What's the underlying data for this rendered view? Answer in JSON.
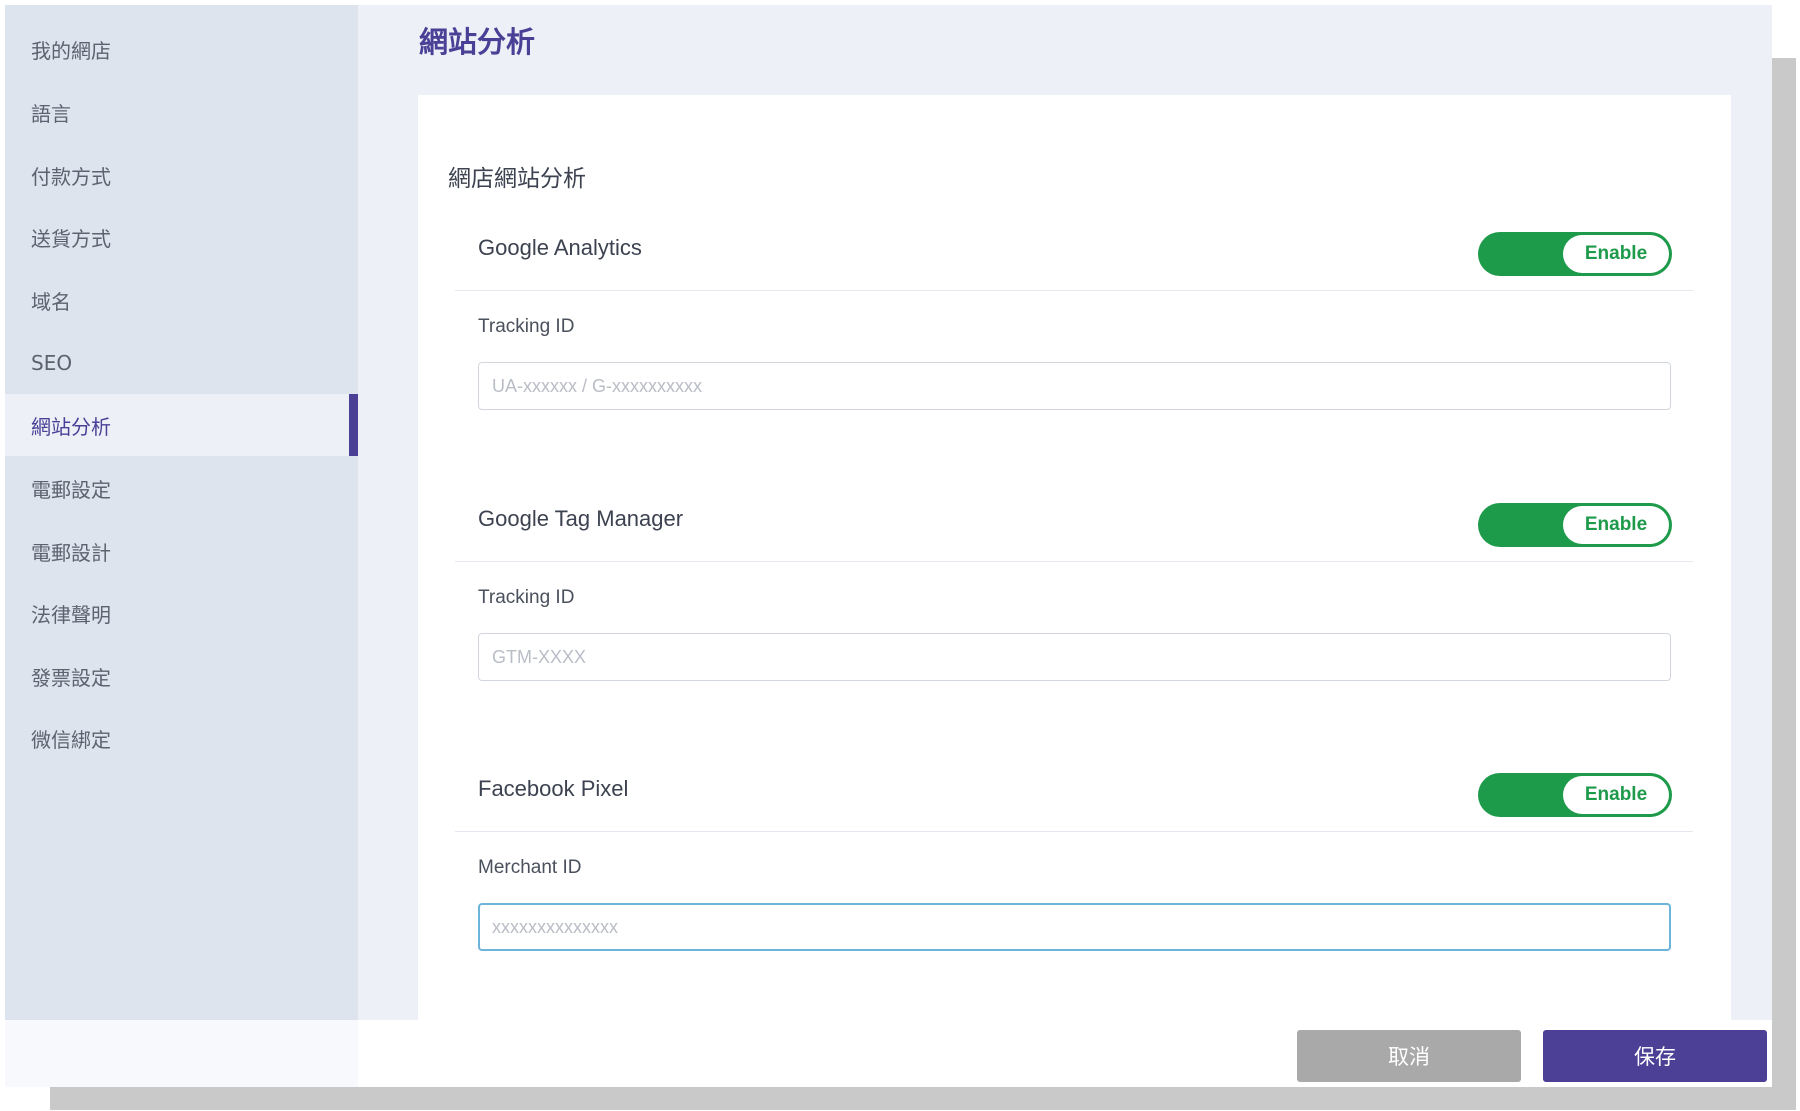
{
  "sidebar": {
    "items": [
      {
        "label": "我的網店"
      },
      {
        "label": "語言"
      },
      {
        "label": "付款方式"
      },
      {
        "label": "送貨方式"
      },
      {
        "label": "域名"
      },
      {
        "label": "SEO"
      },
      {
        "label": "網站分析"
      },
      {
        "label": "電郵設定"
      },
      {
        "label": "電郵設計"
      },
      {
        "label": "法律聲明"
      },
      {
        "label": "發票設定"
      },
      {
        "label": "微信綁定"
      }
    ],
    "active_item": "網站分析"
  },
  "header": {
    "title": "網站分析"
  },
  "card": {
    "title": "網店網站分析",
    "services": [
      {
        "name": "Google Analytics",
        "toggle_label": "Enable",
        "field_label": "Tracking ID",
        "placeholder": "UA-xxxxxx / G-xxxxxxxxxx",
        "value": ""
      },
      {
        "name": "Google Tag Manager",
        "toggle_label": "Enable",
        "field_label": "Tracking ID",
        "placeholder": "GTM-XXXX",
        "value": ""
      },
      {
        "name": "Facebook Pixel",
        "toggle_label": "Enable",
        "field_label": "Merchant ID",
        "placeholder": "xxxxxxxxxxxxxx",
        "value": ""
      }
    ]
  },
  "footer": {
    "cancel_label": "取消",
    "save_label": "保存"
  },
  "colors": {
    "accent": "#4b3f96",
    "toggle_on": "#1e9a4b",
    "cancel_button": "#a9a9a9",
    "sidebar_bg": "#dde4ee",
    "page_bg": "#edf1f7",
    "focus_border": "#6db4db"
  }
}
